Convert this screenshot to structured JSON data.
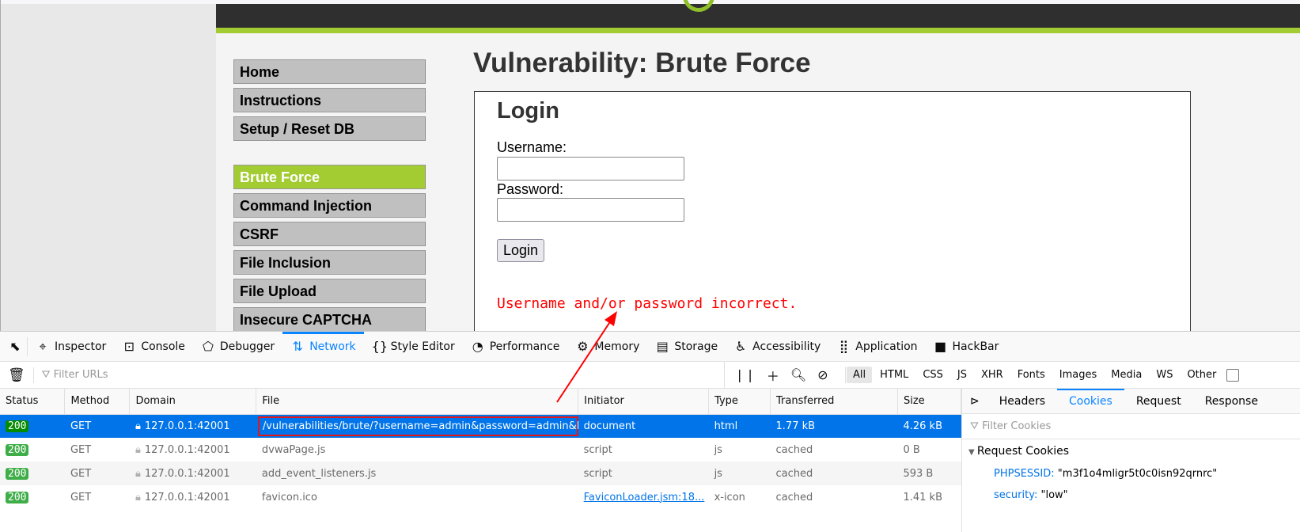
{
  "page": {
    "menu_top": [
      "Home",
      "Instructions",
      "Setup / Reset DB"
    ],
    "menu_vuln": [
      "Brute Force",
      "Command Injection",
      "CSRF",
      "File Inclusion",
      "File Upload",
      "Insecure CAPTCHA"
    ],
    "active_menu": "Brute Force",
    "title": "Vulnerability: Brute Force",
    "login": {
      "heading": "Login",
      "username_label": "Username:",
      "password_label": "Password:",
      "username_value": "",
      "password_value": "",
      "button": "Login",
      "error": "Username and/or password incorrect."
    },
    "colors": {
      "accent": "#a3cb32",
      "header": "#2f2f2f",
      "error": "#ff0000"
    }
  },
  "devtools": {
    "tabs": [
      {
        "icon": "inspector-icon",
        "label": "Inspector"
      },
      {
        "icon": "console-icon",
        "label": "Console"
      },
      {
        "icon": "debugger-icon",
        "label": "Debugger"
      },
      {
        "icon": "network-icon",
        "label": "Network"
      },
      {
        "icon": "style-editor-icon",
        "label": "Style Editor"
      },
      {
        "icon": "performance-icon",
        "label": "Performance"
      },
      {
        "icon": "memory-icon",
        "label": "Memory"
      },
      {
        "icon": "storage-icon",
        "label": "Storage"
      },
      {
        "icon": "accessibility-icon",
        "label": "Accessibility"
      },
      {
        "icon": "application-icon",
        "label": "Application"
      },
      {
        "icon": "hackbar-icon",
        "label": "HackBar"
      }
    ],
    "selected_tab": "Network",
    "filter_placeholder": "Filter URLs",
    "type_filters": [
      "All",
      "HTML",
      "CSS",
      "JS",
      "XHR",
      "Fonts",
      "Images",
      "Media",
      "WS",
      "Other"
    ],
    "columns": [
      "Status",
      "Method",
      "Domain",
      "File",
      "Initiator",
      "Type",
      "Transferred",
      "Size"
    ],
    "rows": [
      {
        "status": "200",
        "method": "GET",
        "domain": "127.0.0.1:42001",
        "file": "/vulnerabilities/brute/?username=admin&password=admin&Login=Login",
        "initiator": "document",
        "type": "html",
        "transferred": "1.77 kB",
        "size": "4.26 kB"
      },
      {
        "status": "200",
        "method": "GET",
        "domain": "127.0.0.1:42001",
        "file": "dvwaPage.js",
        "initiator": "script",
        "type": "js",
        "transferred": "cached",
        "size": "0 B"
      },
      {
        "status": "200",
        "method": "GET",
        "domain": "127.0.0.1:42001",
        "file": "add_event_listeners.js",
        "initiator": "script",
        "type": "js",
        "transferred": "cached",
        "size": "593 B"
      },
      {
        "status": "200",
        "method": "GET",
        "domain": "127.0.0.1:42001",
        "file": "favicon.ico",
        "initiator": "FaviconLoader.jsm:18...",
        "type": "x-icon",
        "transferred": "cached",
        "size": "1.41 kB"
      }
    ],
    "side_tabs": [
      "Headers",
      "Cookies",
      "Request",
      "Response"
    ],
    "selected_side_tab": "Cookies",
    "cookie_filter_placeholder": "Filter Cookies",
    "cookies_section": "Request Cookies",
    "cookies": [
      {
        "name": "PHPSESSID",
        "value": "\"m3f1o4mligr5t0c0isn92qrnrc\""
      },
      {
        "name": "security",
        "value": "\"low\""
      }
    ]
  }
}
